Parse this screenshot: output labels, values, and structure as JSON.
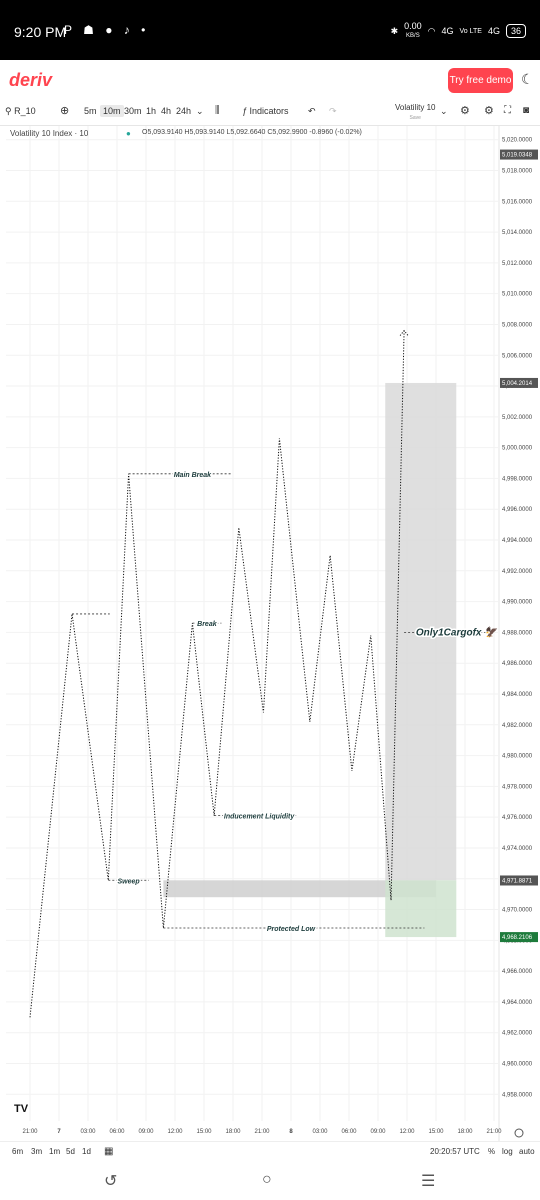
{
  "status": {
    "time": "9:20 PM",
    "left_icons": "P ☗ ● ♪ •",
    "speed": "0.00",
    "speed_unit": "KB/S",
    "net1": "4G",
    "net2": "Vo LTE",
    "net3": "4G",
    "battery": "36"
  },
  "header": {
    "logo": "deriv",
    "try_button": "Try free demo"
  },
  "toolbar": {
    "symbol": "R_10",
    "timeframes": [
      "5m",
      "10m",
      "30m",
      "1h",
      "4h",
      "24h"
    ],
    "active_timeframe": "10m",
    "indicators": "Indicators",
    "chart_name": "Volatility 10",
    "save_label": "Save"
  },
  "legend": {
    "title": "Volatility 10 Index · 10",
    "ohlc": "O5,093.9140  H5,093.9140  L5,092.6640  C5,092.9900  -0.8960 (-0.02%)"
  },
  "chart_data": {
    "type": "line",
    "title": "Volatility 10 Index · 10",
    "y_axis_ticks": [
      "5,020.0000",
      "5,018.0000",
      "5,016.0000",
      "5,014.0000",
      "5,012.0000",
      "5,010.0000",
      "5,008.0000",
      "5,006.0000",
      "5,004.0000",
      "5,002.0000",
      "5,000.0000",
      "4,998.0000",
      "4,996.0000",
      "4,994.0000",
      "4,992.0000",
      "4,990.0000",
      "4,988.0000",
      "4,986.0000",
      "4,984.0000",
      "4,982.0000",
      "4,980.0000",
      "4,978.0000",
      "4,976.0000",
      "4,974.0000",
      "4,972.0000",
      "4,970.0000",
      "4,968.0000",
      "4,966.0000",
      "4,964.0000",
      "4,962.0000",
      "4,960.0000",
      "4,958.0000"
    ],
    "ylim": [
      4957.5,
      5020.5
    ],
    "x_axis_ticks": [
      "21:00",
      "7",
      "03:00",
      "06:00",
      "09:00",
      "12:00",
      "15:00",
      "18:00",
      "21:00",
      "8",
      "03:00",
      "06:00",
      "09:00",
      "12:00",
      "15:00",
      "18:00",
      "21:00"
    ],
    "price_labels": [
      {
        "value": 5019.0348,
        "text": "5,019.0348",
        "color": "#555555"
      },
      {
        "value": 5004.2014,
        "text": "5,004.2014",
        "color": "#555555"
      },
      {
        "value": 4971.8871,
        "text": "4,971.8871",
        "color": "#555555"
      },
      {
        "value": 4968.2106,
        "text": "4,968.2106",
        "color": "#1e7b3c"
      }
    ],
    "path_points": [
      {
        "x": 0.0,
        "y": 4963.0
      },
      {
        "x": 1.45,
        "y": 4989.2
      },
      {
        "x": 2.7,
        "y": 4971.9
      },
      {
        "x": 3.4,
        "y": 4998.3
      },
      {
        "x": 4.6,
        "y": 4968.8
      },
      {
        "x": 5.6,
        "y": 4988.6
      },
      {
        "x": 6.35,
        "y": 4976.1
      },
      {
        "x": 7.2,
        "y": 4994.8
      },
      {
        "x": 8.05,
        "y": 4982.8
      },
      {
        "x": 8.6,
        "y": 5000.6
      },
      {
        "x": 9.65,
        "y": 4982.2
      },
      {
        "x": 10.35,
        "y": 4993.0
      },
      {
        "x": 11.1,
        "y": 4979.0
      },
      {
        "x": 11.75,
        "y": 4987.8
      },
      {
        "x": 12.45,
        "y": 4970.6
      },
      {
        "x": 12.9,
        "y": 5007.6
      }
    ],
    "annotations": [
      {
        "text": "Main Break",
        "level": 4998.3,
        "x": 5.6
      },
      {
        "text": "Break",
        "level": 4988.6,
        "x": 6.1
      },
      {
        "text": "Inducement Liquidity",
        "level": 4976.1,
        "x": 7.9
      },
      {
        "text": "Sweep",
        "level": 4971.9,
        "x": 3.4
      },
      {
        "text": "Protected Low",
        "level": 4968.8,
        "x": 9.0
      },
      {
        "text": "Only1Cargofx 🦅",
        "level": 4988.0,
        "x": 14.7
      }
    ],
    "zones": [
      {
        "name": "demand-zone",
        "x_from": 4.6,
        "x_to": 14.0,
        "y_from": 4970.8,
        "y_to": 4971.9,
        "color": "#cfcfcf"
      },
      {
        "name": "position-target-zone",
        "x_from": 12.25,
        "x_to": 14.7,
        "y_from": 4971.9,
        "y_to": 5004.2014,
        "color": "#d9d9d9"
      },
      {
        "name": "position-stop-zone",
        "x_from": 12.25,
        "x_to": 14.7,
        "y_from": 4968.2106,
        "y_to": 4971.9,
        "color": "#cfe3cf"
      }
    ],
    "grid": true
  },
  "bottom": {
    "ranges": [
      "6m",
      "3m",
      "1m",
      "5d",
      "1d"
    ],
    "clock": "20:20:57 UTC",
    "percent": "%",
    "log": "log",
    "auto": "auto"
  },
  "nav": {
    "back": "↺",
    "home": "○",
    "menu": "☰"
  }
}
